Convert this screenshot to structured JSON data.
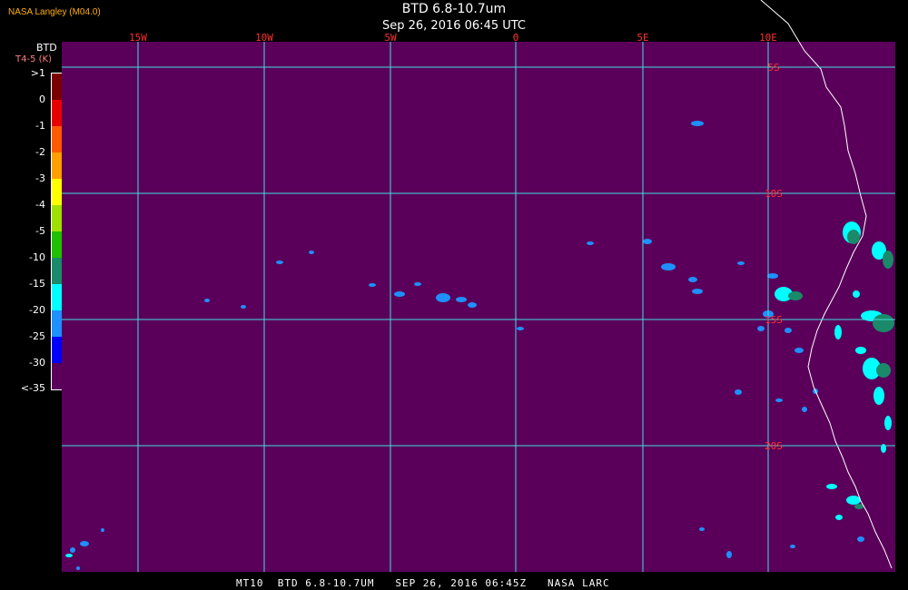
{
  "header": {
    "credit": "NASA Langley (M04.0)",
    "title": "BTD 6.8-10.7um",
    "subtitle": "Sep 26, 2016 06:45 UTC"
  },
  "legend": {
    "title": "BTD",
    "unit": "T4-5 (K)",
    "labels": [
      ">1",
      "0",
      "-1",
      "-2",
      "-3",
      "-4",
      "-5",
      "-10",
      "-15",
      "-20",
      "-25",
      "-30",
      "<-35"
    ],
    "colors": [
      "#7a0000",
      "#e80000",
      "#ff5a00",
      "#ff9f00",
      "#ffff00",
      "#a0e000",
      "#20c000",
      "#1a8a6a",
      "#00ffff",
      "#1e90ff",
      "#0000ff",
      "#5a005a"
    ]
  },
  "map": {
    "background": "#5a005a",
    "grid_color": "#40e0e0",
    "lon_labels": [
      "15W",
      "10W",
      "5W",
      "0",
      "5E",
      "10E"
    ],
    "lat_labels": [
      "5S",
      "10S",
      "15S",
      "20S"
    ],
    "label_color": "#ff3030"
  },
  "footer": {
    "text": "MT10  BTD 6.8-10.7UM   SEP 26, 2016 06:45Z   NASA LARC"
  }
}
